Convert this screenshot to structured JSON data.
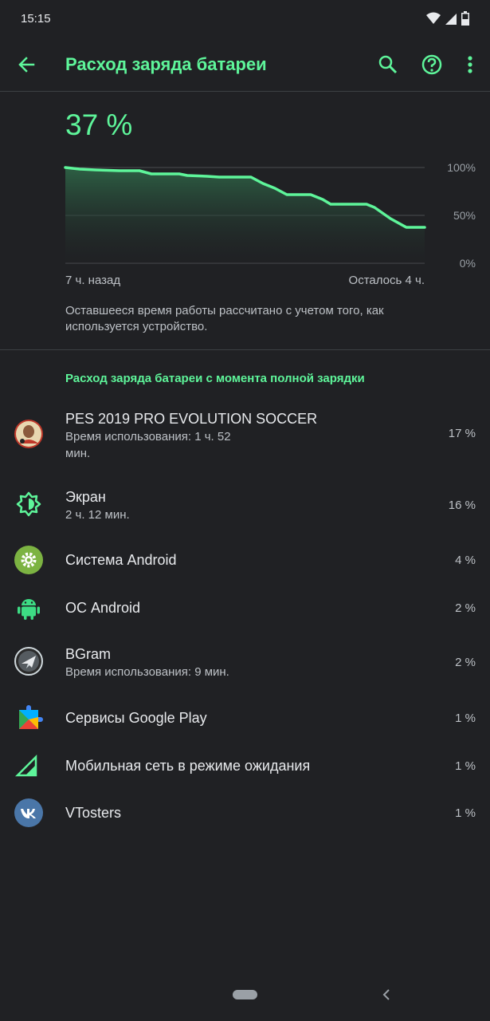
{
  "status": {
    "time": "15:15"
  },
  "toolbar": {
    "title": "Расход заряда батареи"
  },
  "battery": {
    "level": "37 %",
    "chart_labels": {
      "top": "100%",
      "mid": "50%",
      "bottom": "0%"
    },
    "time_left": "7 ч. назад",
    "time_right": "Осталось 4 ч.",
    "note": "Оставшееся время работы рассчитано с учетом того, как используется устройство."
  },
  "section": {
    "title": "Расход заряда батареи с момента полной зарядки"
  },
  "apps": [
    {
      "name": "PES 2019 PRO EVOLUTION SOCCER",
      "sub": "Время использования: 1 ч. 52 мин.",
      "pct": "17 %",
      "icon": "pes-app-icon"
    },
    {
      "name": "Экран",
      "sub": "2 ч. 12 мин.",
      "pct": "16 %",
      "icon": "screen-brightness-icon"
    },
    {
      "name": "Система Android",
      "sub": "",
      "pct": "4 %",
      "icon": "android-system-gear-icon"
    },
    {
      "name": "ОС Android",
      "sub": "",
      "pct": "2 %",
      "icon": "android-robot-icon"
    },
    {
      "name": "BGram",
      "sub": "Время использования: 9 мин.",
      "pct": "2 %",
      "icon": "bgram-app-icon"
    },
    {
      "name": "Сервисы Google Play",
      "sub": "",
      "pct": "1 %",
      "icon": "google-play-services-icon"
    },
    {
      "name": "Мобильная сеть в режиме ожидания",
      "sub": "",
      "pct": "1 %",
      "icon": "cell-signal-icon"
    },
    {
      "name": "VTosters",
      "sub": "",
      "pct": "1 %",
      "icon": "vk-app-icon"
    }
  ],
  "colors": {
    "accent": "#5ef59a",
    "background": "#202124",
    "text": "#e8eaed",
    "secondary": "#bdc1c6"
  }
}
